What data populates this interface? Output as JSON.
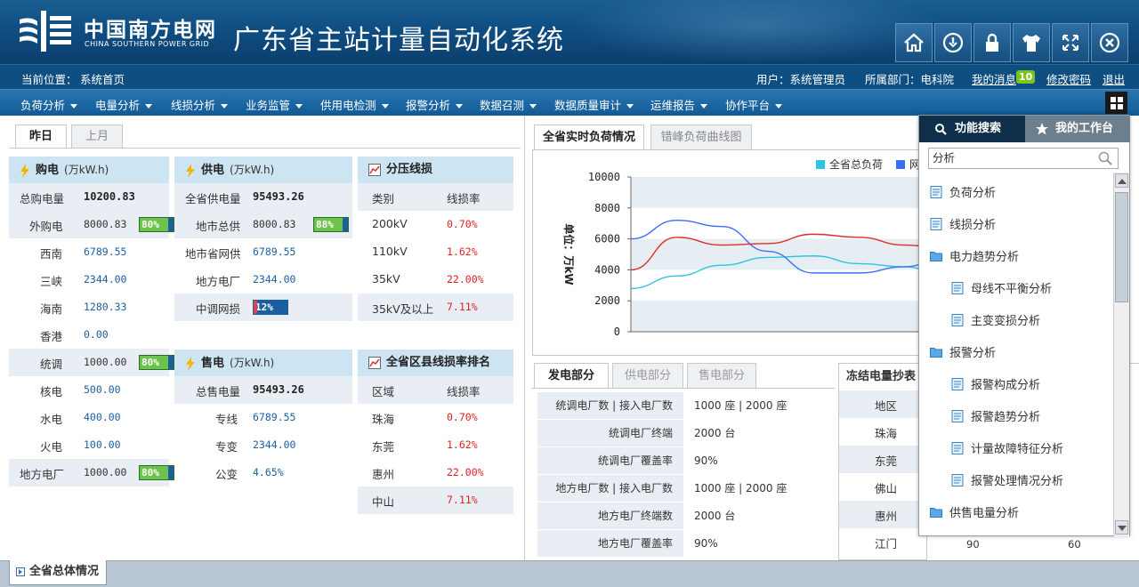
{
  "header": {
    "logo_cn": "中国南方电网",
    "logo_en": "CHINA SOUTHERN POWER GRID",
    "system_title": "广东省主站计量自动化系统",
    "toolbar_icons": [
      "home-icon",
      "power-icon",
      "lock-icon",
      "shirt-icon",
      "fullscreen-icon",
      "close-icon"
    ]
  },
  "locbar": {
    "location_label": "当前位置：",
    "location_value": "系统首页",
    "user": "用户：系统管理员",
    "dept": "所属部门：电科院",
    "messages": "我的消息",
    "message_count": "10",
    "change_pwd": "修改密码",
    "logout": "退出"
  },
  "menu": [
    "负荷分析",
    "电量分析",
    "线损分析",
    "业务监管",
    "供用电检测",
    "报警分析",
    "数据召测",
    "数据质量审计",
    "运维报告",
    "协作平台"
  ],
  "left_tabs": [
    "昨日",
    "上月"
  ],
  "purchase": {
    "title": "购电",
    "unit": "(万kW.h)",
    "rows": [
      {
        "k": "总购电量",
        "v": "10200.83"
      },
      {
        "k": "外购电",
        "v": "8000.83",
        "pct": "80%"
      },
      {
        "k": "西南",
        "v": "6789.55"
      },
      {
        "k": "三峡",
        "v": "2344.00"
      },
      {
        "k": "海南",
        "v": "1280.33"
      },
      {
        "k": "香港",
        "v": "0.00"
      },
      {
        "k": "统调",
        "v": "1000.00",
        "pct": "80%"
      },
      {
        "k": "核电",
        "v": "500.00"
      },
      {
        "k": "水电",
        "v": "400.00"
      },
      {
        "k": "火电",
        "v": "100.00"
      },
      {
        "k": "地方电厂",
        "v": "1000.00",
        "pct": "80%"
      }
    ]
  },
  "supply": {
    "title": "供电",
    "unit": "(万kW.h)",
    "rows": [
      {
        "k": "全省供电量",
        "v": "95493.26"
      },
      {
        "k": "地市总供",
        "v": "8000.83",
        "pct": "88%"
      },
      {
        "k": "地市省网供",
        "v": "6789.55"
      },
      {
        "k": "地方电厂",
        "v": "2344.00"
      },
      {
        "k": "中调网损",
        "pct": "12%"
      }
    ]
  },
  "sale": {
    "title": "售电",
    "unit": "(万kW.h)",
    "rows": [
      {
        "k": "总售电量",
        "v": "95493.26"
      },
      {
        "k": "专线",
        "v": "6789.55"
      },
      {
        "k": "专变",
        "v": "2344.00"
      },
      {
        "k": "公变",
        "v": "4.65%"
      }
    ]
  },
  "voltage_loss": {
    "title": "分压线损",
    "col1": "类别",
    "col2": "线损率",
    "rows": [
      {
        "k": "200kV",
        "v": "0.70%"
      },
      {
        "k": "110kV",
        "v": "1.62%"
      },
      {
        "k": "35kV",
        "v": "22.00%"
      },
      {
        "k": "35kV及以上",
        "v": "7.11%"
      }
    ]
  },
  "county_loss": {
    "title": "全省区县线损率排名",
    "col1": "区域",
    "col2": "线损率",
    "rows": [
      {
        "k": "珠海",
        "v": "0.70%"
      },
      {
        "k": "东莞",
        "v": "1.62%"
      },
      {
        "k": "惠州",
        "v": "22.00%"
      },
      {
        "k": "中山",
        "v": "7.11%"
      }
    ]
  },
  "chart_tabs": [
    "全省实时负荷情况",
    "错峰负荷曲线图"
  ],
  "chart_data": {
    "type": "line",
    "ylabel": "单位：万kW",
    "ylim": [
      0,
      10000
    ],
    "yticks": [
      "10000",
      "8000",
      "6000",
      "4000",
      "2000",
      "0"
    ],
    "legend": [
      "全省总负荷",
      "网"
    ],
    "series": [
      {
        "name": "全省总负荷",
        "color": "#2ec4e0",
        "values": [
          2800,
          3600,
          4300,
          4800,
          4900,
          4400,
          4200,
          3500,
          3600
        ]
      },
      {
        "name": "网",
        "color": "#3b6ef5",
        "values": [
          6000,
          7200,
          6800,
          5200,
          3800,
          3800,
          4200,
          5000,
          5500
        ]
      },
      {
        "name": "",
        "color": "#e02c2c",
        "values": [
          4000,
          6100,
          5600,
          5700,
          6300,
          6100,
          5600,
          5300,
          5400
        ]
      }
    ]
  },
  "bottom_tabs": [
    "发电部分",
    "供电部分",
    "售电部分"
  ],
  "gen_rows": [
    {
      "k": "统调电厂数 | 接入电厂数",
      "v": "1000 座 | 2000 座"
    },
    {
      "k": "统调电厂终端",
      "v": "2000 台"
    },
    {
      "k": "统调电厂覆盖率",
      "v": "90%"
    },
    {
      "k": "地方电厂数 | 接入电厂数",
      "v": "1000 座 | 2000 座"
    },
    {
      "k": "地方电厂终端数",
      "v": "2000 台"
    },
    {
      "k": "地方电厂覆盖率",
      "v": "90%"
    }
  ],
  "frozen": {
    "title": "冻结电量抄表",
    "col": "地区",
    "rows": [
      "珠海",
      "东莞",
      "佛山",
      "惠州",
      "江门"
    ],
    "last_vals": [
      "90",
      "60"
    ]
  },
  "popup": {
    "tab_search": "功能搜索",
    "tab_work": "我的工作台",
    "search_value": "分析",
    "items": [
      {
        "label": "负荷分析",
        "level": 0,
        "folder": false
      },
      {
        "label": "线损分析",
        "level": 0,
        "folder": false
      },
      {
        "label": "电力趋势分析",
        "level": 0,
        "folder": true
      },
      {
        "label": "母线不平衡分析",
        "level": 1,
        "folder": false
      },
      {
        "label": "主变变损分析",
        "level": 1,
        "folder": false
      },
      {
        "label": "报警分析",
        "level": 0,
        "folder": true
      },
      {
        "label": "报警构成分析",
        "level": 1,
        "folder": false
      },
      {
        "label": "报警趋势分析",
        "level": 1,
        "folder": false
      },
      {
        "label": "计量故障特征分析",
        "level": 1,
        "folder": false
      },
      {
        "label": "报警处理情况分析",
        "level": 1,
        "folder": false
      },
      {
        "label": "供售电量分析",
        "level": 0,
        "folder": true
      }
    ]
  },
  "footer": {
    "tab": "全省总体情况"
  }
}
